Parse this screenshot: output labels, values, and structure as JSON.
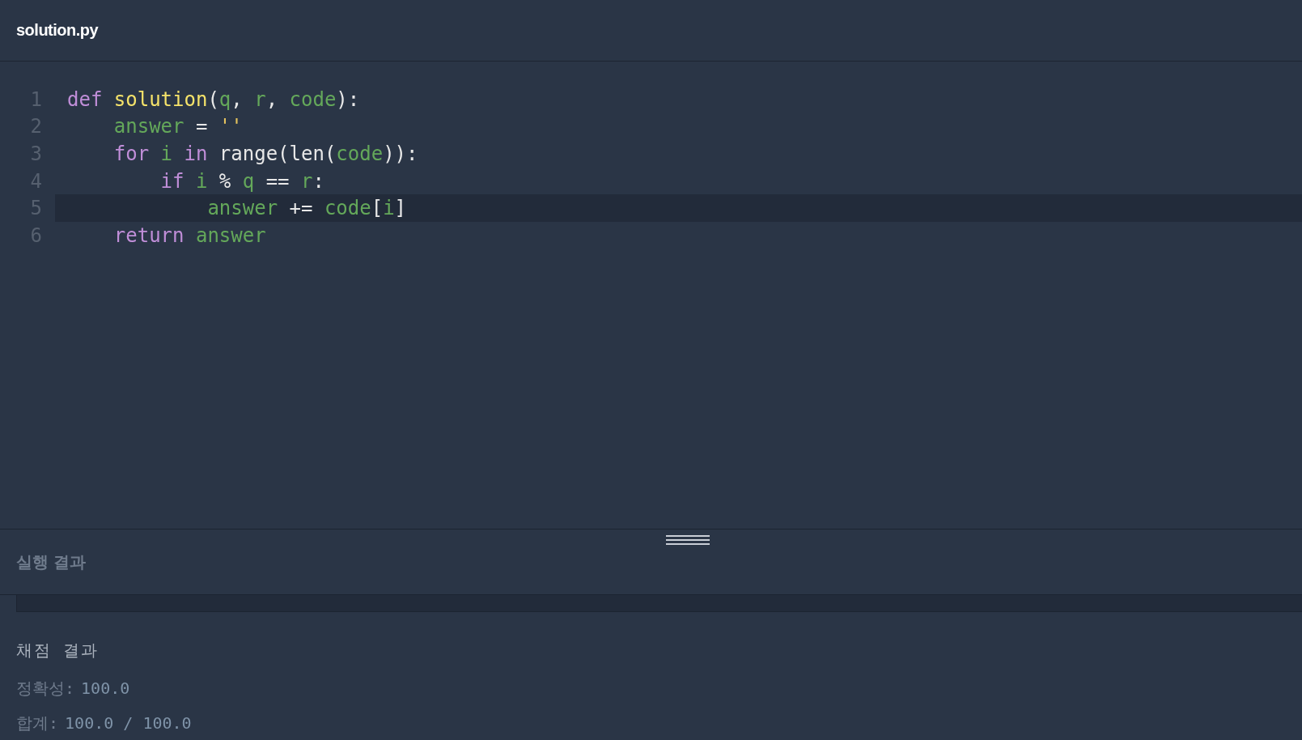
{
  "editor": {
    "filename": "solution.py",
    "lines": [
      {
        "number": "1",
        "current": false,
        "tokens": [
          {
            "kind": "keyword",
            "text": "def "
          },
          {
            "kind": "function",
            "text": "solution"
          },
          {
            "kind": "plain",
            "text": "("
          },
          {
            "kind": "variable",
            "text": "q"
          },
          {
            "kind": "plain",
            "text": ", "
          },
          {
            "kind": "variable",
            "text": "r"
          },
          {
            "kind": "plain",
            "text": ", "
          },
          {
            "kind": "variable",
            "text": "code"
          },
          {
            "kind": "plain",
            "text": "):"
          }
        ]
      },
      {
        "number": "2",
        "current": false,
        "tokens": [
          {
            "kind": "variable",
            "text": "    answer"
          },
          {
            "kind": "plain",
            "text": " = "
          },
          {
            "kind": "string",
            "text": "''"
          }
        ]
      },
      {
        "number": "3",
        "current": false,
        "tokens": [
          {
            "kind": "keyword",
            "text": "    for "
          },
          {
            "kind": "variable",
            "text": "i "
          },
          {
            "kind": "keyword",
            "text": "in "
          },
          {
            "kind": "plain",
            "text": "range(len("
          },
          {
            "kind": "variable",
            "text": "code"
          },
          {
            "kind": "plain",
            "text": ")):"
          }
        ]
      },
      {
        "number": "4",
        "current": false,
        "tokens": [
          {
            "kind": "keyword",
            "text": "        if "
          },
          {
            "kind": "variable",
            "text": "i "
          },
          {
            "kind": "plain",
            "text": "% "
          },
          {
            "kind": "variable",
            "text": "q "
          },
          {
            "kind": "plain",
            "text": "== "
          },
          {
            "kind": "variable",
            "text": "r"
          },
          {
            "kind": "plain",
            "text": ":"
          }
        ]
      },
      {
        "number": "5",
        "current": true,
        "tokens": [
          {
            "kind": "variable",
            "text": "            answer "
          },
          {
            "kind": "plain",
            "text": "+= "
          },
          {
            "kind": "variable",
            "text": "code"
          },
          {
            "kind": "plain",
            "text": "["
          },
          {
            "kind": "variable",
            "text": "i"
          },
          {
            "kind": "plain",
            "text": "]"
          }
        ]
      },
      {
        "number": "6",
        "current": false,
        "tokens": [
          {
            "kind": "keyword",
            "text": "    return "
          },
          {
            "kind": "variable",
            "text": "answer"
          }
        ]
      }
    ]
  },
  "results": {
    "title": "실행 결과",
    "grading": {
      "title": "채점 결과",
      "rows": [
        {
          "label": "정확성:",
          "value": "100.0"
        },
        {
          "label": "합계:",
          "value": "100.0 / 100.0"
        }
      ]
    }
  }
}
